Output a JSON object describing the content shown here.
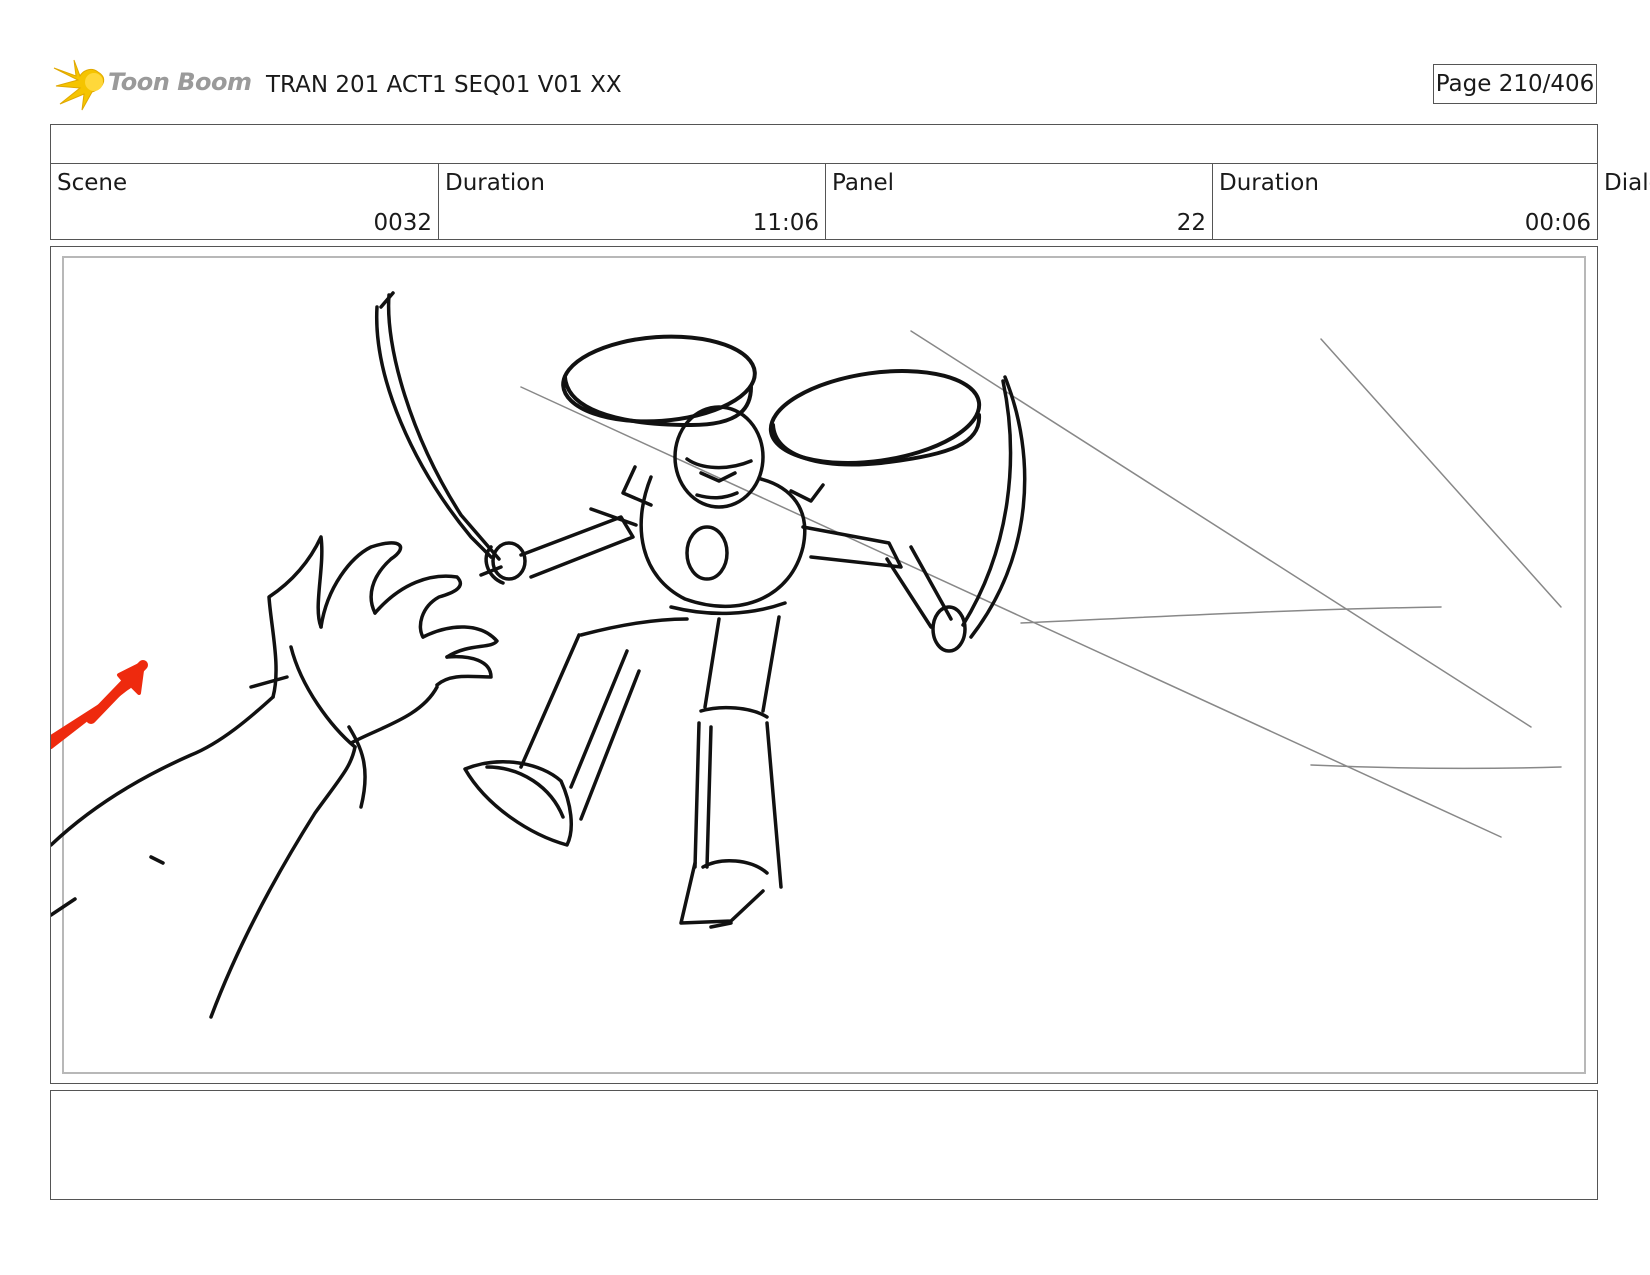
{
  "header": {
    "brand": "Toon Boom",
    "title": "TRAN 201 ACT1 SEQ01 V01 XX",
    "page": "Page 210/406"
  },
  "fields": {
    "scene_label": "Scene",
    "scene_value": "0032",
    "scene_duration_label": "Duration",
    "scene_duration_value": "11:06",
    "panel_label": "Panel",
    "panel_value": "22",
    "panel_duration_label": "Duration",
    "panel_duration_value": "00:06",
    "dialog_label": "Dialo"
  },
  "colors": {
    "logo_flame": "#f5c400",
    "logo_text": "#9a9a9a",
    "arrow": "#ee2a0e",
    "line_ink": "#111111",
    "border": "#555555"
  },
  "icons": [
    "toon-boom-logo",
    "red-arrow-icon"
  ]
}
